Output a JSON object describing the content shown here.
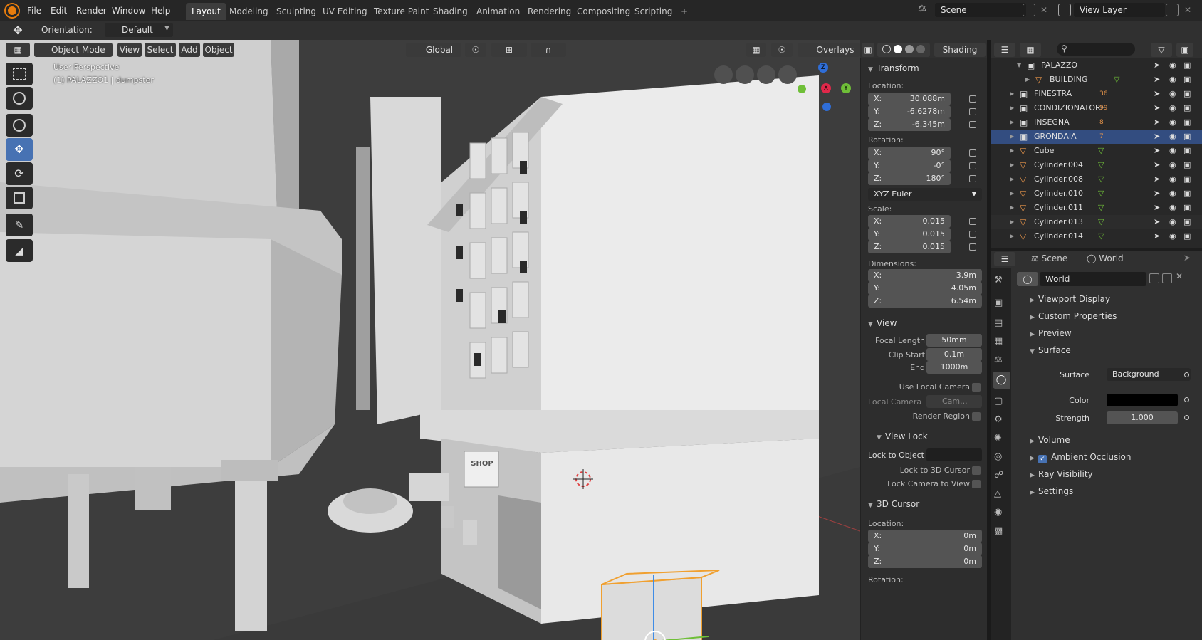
{
  "app": {
    "menu": [
      "File",
      "Edit",
      "Render",
      "Window",
      "Help"
    ],
    "workspaces": [
      "Layout",
      "Modeling",
      "Sculpting",
      "UV Editing",
      "Texture Paint",
      "Shading",
      "Animation",
      "Rendering",
      "Compositing",
      "Scripting"
    ],
    "active_workspace": "Layout",
    "add_tab": "+",
    "scene": "Scene",
    "view_layer": "View Layer"
  },
  "toolbar": {
    "orientation_label": "Orientation:",
    "orientation_value": "Default"
  },
  "viewport_header": {
    "mode": "Object Mode",
    "view": "View",
    "select": "Select",
    "add": "Add",
    "object": "Object",
    "transform_orientation": "Global",
    "overlays": "Overlays",
    "shading": "Shading"
  },
  "viewport": {
    "perspective": "User Perspective",
    "active_object": "(1) PALAZZO1 | dumpster",
    "shop_sign": "SHOP",
    "gizmo": {
      "x": "X",
      "y": "Y",
      "z": "Z"
    }
  },
  "npanel": {
    "transform_title": "Transform",
    "location_label": "Location:",
    "location": [
      {
        "k": "X:",
        "v": "30.088m"
      },
      {
        "k": "Y:",
        "v": "-6.6278m"
      },
      {
        "k": "Z:",
        "v": "-6.345m"
      }
    ],
    "rotation_label": "Rotation:",
    "rotation": [
      {
        "k": "X:",
        "v": "90°"
      },
      {
        "k": "Y:",
        "v": "-0°"
      },
      {
        "k": "Z:",
        "v": "180°"
      }
    ],
    "rotation_mode": "XYZ Euler",
    "scale_label": "Scale:",
    "scale": [
      {
        "k": "X:",
        "v": "0.015"
      },
      {
        "k": "Y:",
        "v": "0.015"
      },
      {
        "k": "Z:",
        "v": "0.015"
      }
    ],
    "dimensions_label": "Dimensions:",
    "dimensions": [
      {
        "k": "X:",
        "v": "3.9m"
      },
      {
        "k": "Y:",
        "v": "4.05m"
      },
      {
        "k": "Z:",
        "v": "6.54m"
      }
    ],
    "view_title": "View",
    "focal_length_label": "Focal Length",
    "focal_length": "50mm",
    "clip_start_label": "Clip Start",
    "clip_start": "0.1m",
    "clip_end_label": "End",
    "clip_end": "1000m",
    "use_local_camera": "Use Local Camera",
    "local_camera_label": "Local Camera",
    "local_camera_value": "Cam...",
    "render_region": "Render Region",
    "view_lock_title": "View Lock",
    "lock_to_object": "Lock to Object",
    "lock_to_3d_cursor": "Lock to 3D Cursor",
    "lock_camera_to_view": "Lock Camera to View",
    "cursor_title": "3D Cursor",
    "cursor_location_label": "Location:",
    "cursor_location": [
      {
        "k": "X:",
        "v": "0m"
      },
      {
        "k": "Y:",
        "v": "0m"
      },
      {
        "k": "Z:",
        "v": "0m"
      }
    ],
    "cursor_rotation_label": "Rotation:"
  },
  "outliner": {
    "rows": [
      {
        "name": "PALAZZO",
        "type": "collection",
        "badge": ""
      },
      {
        "name": "BUILDING",
        "type": "mesh",
        "badge": ""
      },
      {
        "name": "FINESTRA",
        "type": "collection",
        "badge": "36"
      },
      {
        "name": "CONDIZIONATORE",
        "type": "collection",
        "badge": "99"
      },
      {
        "name": "INSEGNA",
        "type": "collection",
        "badge": "8"
      },
      {
        "name": "GRONDAIA",
        "type": "collection",
        "badge": "7"
      },
      {
        "name": "Cube",
        "type": "mesh",
        "badge": ""
      },
      {
        "name": "Cylinder.004",
        "type": "mesh",
        "badge": ""
      },
      {
        "name": "Cylinder.008",
        "type": "mesh",
        "badge": ""
      },
      {
        "name": "Cylinder.010",
        "type": "mesh",
        "badge": ""
      },
      {
        "name": "Cylinder.011",
        "type": "mesh",
        "badge": ""
      },
      {
        "name": "Cylinder.013",
        "type": "mesh",
        "badge": ""
      },
      {
        "name": "Cylinder.014",
        "type": "mesh",
        "badge": ""
      }
    ]
  },
  "properties": {
    "scene_tab": "Scene",
    "world_tab": "World",
    "world_name": "World",
    "viewport_display": "Viewport Display",
    "custom_properties": "Custom Properties",
    "preview": "Preview",
    "surface": "Surface",
    "surface_label": "Surface",
    "surface_value": "Background",
    "color_label": "Color",
    "color_value": "#000000",
    "strength_label": "Strength",
    "strength_value": "1.000",
    "volume": "Volume",
    "ambient_occlusion": "Ambient Occlusion",
    "ray_visibility": "Ray Visibility",
    "settings": "Settings"
  }
}
